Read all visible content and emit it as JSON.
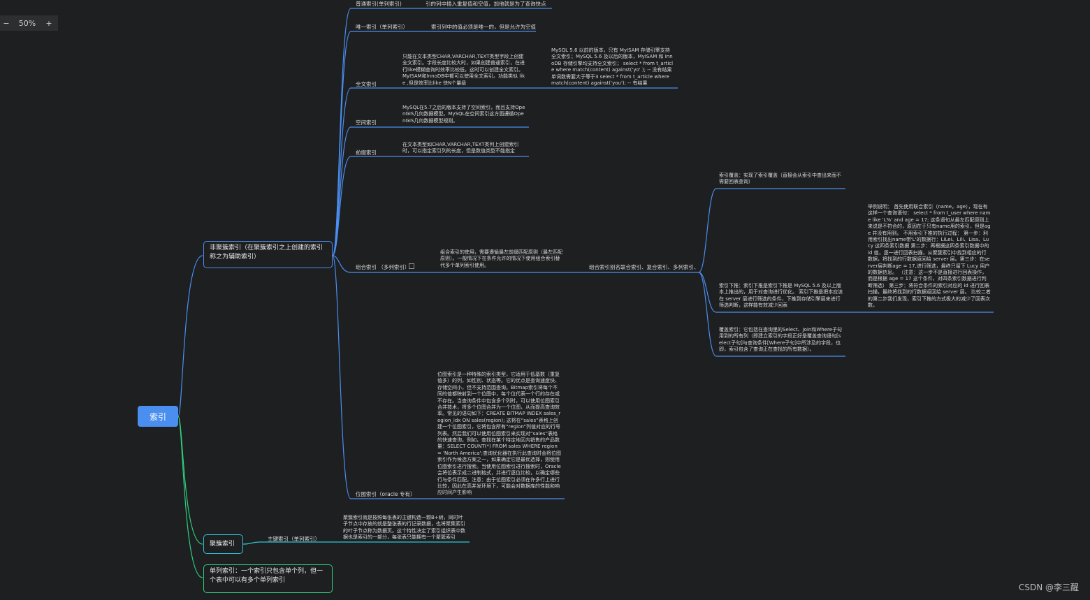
{
  "zoom": {
    "minus": "−",
    "value": "50%",
    "plus": "+"
  },
  "root": "索引",
  "level1": {
    "nonclustered": "非聚簇索引（在聚簇索引之上创建的索引称之为辅助索引）",
    "clustered": "聚簇索引",
    "single": "单列索引：一个索引只包含单个列，但一个表中可以有多个单列索引"
  },
  "nodes": {
    "normal_label": "普通索引(单列索引)",
    "normal_desc": "引的列中插入重复值和空值，加他就是为了查询快点",
    "unique_label": "唯一索引（单列索引）",
    "unique_desc": "索引列中的值必须是唯一的，但是允许为空值",
    "fulltext_label": "全文索引",
    "fulltext_desc": "只能在文本类型CHAR,VARCHAR,TEXT类型字段上创建全文索引。字段长度比较大时，如果创建普通索引，在进行like模糊查询时效率比较低，这时可以创建全文索引。MyISAM和InnoDB中都可以使用全文索引。功能类似 like ,但是效率比like 快N个量级",
    "fulltext_note": "MySQL 5.6 以前的版本，只有 MyISAM 存储引擎支持全文索引；MySQL 5.6 及以后的版本，MyISAM 和 InnoDB 存储引擎均支持全文索引； select * from t_article where match(content) against('yo'  ); -- 没有结果 单词数需要大于等于3 select * from t_article where match(content) against('you'); -- 有结果",
    "spatial_label": "空间索引",
    "spatial_desc": "MySQL在5.7之后的版本支持了空间索引，而且支持OpenGIS几何数据模型。MySQL在空间索引这方面遵循OpenGIS几何数据模型规则。",
    "prefix_label": "前缀索引",
    "prefix_desc": "在文本类型如CHAR,VARCHAR,TEXT类列上创建索引时，可以指定索引列的长度，但是数值类型不能指定",
    "composite_label": "组合索引 （多列索引）",
    "composite_desc": "组合索引的使用，需要遵循最左前缀匹配原则（最左匹配原则）。一般情况下在条件允许的情况下使用组合索引替代多个单列索引使用。",
    "composite_alias": "组合索引别名联合索引、复合索引、多列索引、",
    "cover_top": "索引覆盖：实现了索引覆盖（直接会从索引中查出来而不需要回表查询）",
    "icp": "索引下推：索引下推是索引下推是 MySQL 5.6 及以上版本上推出的，用于对查询进行优化。 索引下推是把本应该在 server 层进行筛选的条件，下推到存储引擎层来进行筛选判断，这样能有效减少回表",
    "icp_example": "举例说明： 首先使用联合索引（name，age），现在有这样一个查询语句： select * from t_user where name like 'L%' and age = 17; 这条语句从最左匹配原则上来说是不符合的，原因在于只有name用的索引，但是age 并没有用到。 不用索引下推的执行过程： 第一步：利用索引找出name带'L'的数据行：LiLei、Lili、Lisa、Lucy 这四条索引数据 第二步：再根据这四条索引数据中的 id 值，逐一进行回表扫描，从聚簇索引中找到相应的行数据，将找到的行数据返回给 server 层。第三步：在server层判断age = 17,进行筛选，最终只留下 Lucy 用户的数据信息。 （注意：这一步不是直接进行回表操作，而是根据 age = 17 这个条件，对四条索引数据进行判断筛选） 第三步：将符合条件的索引对应的 id 进行回表扫描，最终将找到的行数据返回给 server 层。 比较二者的第二步我们发现，索引下推的方式极大的减少了回表次数。",
    "cover_bottom": "覆盖索引：它包括在查询里的Select、Join和Where子句用到的所有列（即建立索引的字段正好是覆盖查询语句[select子句]与查询条件[Where子句]中所涉及的字段，也即，索引包含了查询正在查找的所有数据）。",
    "bitmap_label": "位图索引（oracle 专有）",
    "bitmap_desc": "位图索引是一种特殊的索引类型，它适用于低基数（重复值多）的列，如性别、状态等。它的优点是查询速度快、存储空间小，但不支持范围查询。Bitmap索引将每个不同的值都映射到一个位图中，每个位代表一个行的存在或不存在。当查询条件中包含多个列时，可以使用位图索引合并技术，将多个位图合并为一个位图，从而提高查询效率。常见的语句如下：CREATE BITMAP INDEX sales_region_idx ON sales(region); 这将在“sales”表格上创建一个位图索引，它将包含所有“region”列值对应的行号列表。然后我们可以使用位图索引来实现对“sales”表格的快速查询。例如，查找在某个特定地区内销售的产品数量：SELECT COUNT(*) FROM sales WHERE region = 'North America';查询优化器在执行此查询时会将位图索引作为候选方案之一，如果确定它是最优选择，则使用位图索引进行搜索。当使用位图索引进行搜索时，Oracle会将位表示成二进制格式，并进行逐位比较，以确定哪些行与条件匹配。注意：由于位图索引必须在许多行上进行比较，因此在高并发环境下，可能会对数据库的性能和响应时间产生影响",
    "primary_label": "主键索引（单列索引）",
    "primary_desc": "聚簇索引就是按照每张表的主键构造一颗B+树，同时叶子节点中存放的就是整张表的行记录数据，也将聚集索引的叶子节点称为数据页。这个特性决定了索引组织表中数据也是索引的一部分，每张表只能拥有一个聚簇索引"
  },
  "watermark": "CSDN @李三醒",
  "colors": {
    "bg": "#1e1f21",
    "blue": "#4a8ff0",
    "green": "#2fcf7f",
    "teal": "#2ec4d6"
  }
}
